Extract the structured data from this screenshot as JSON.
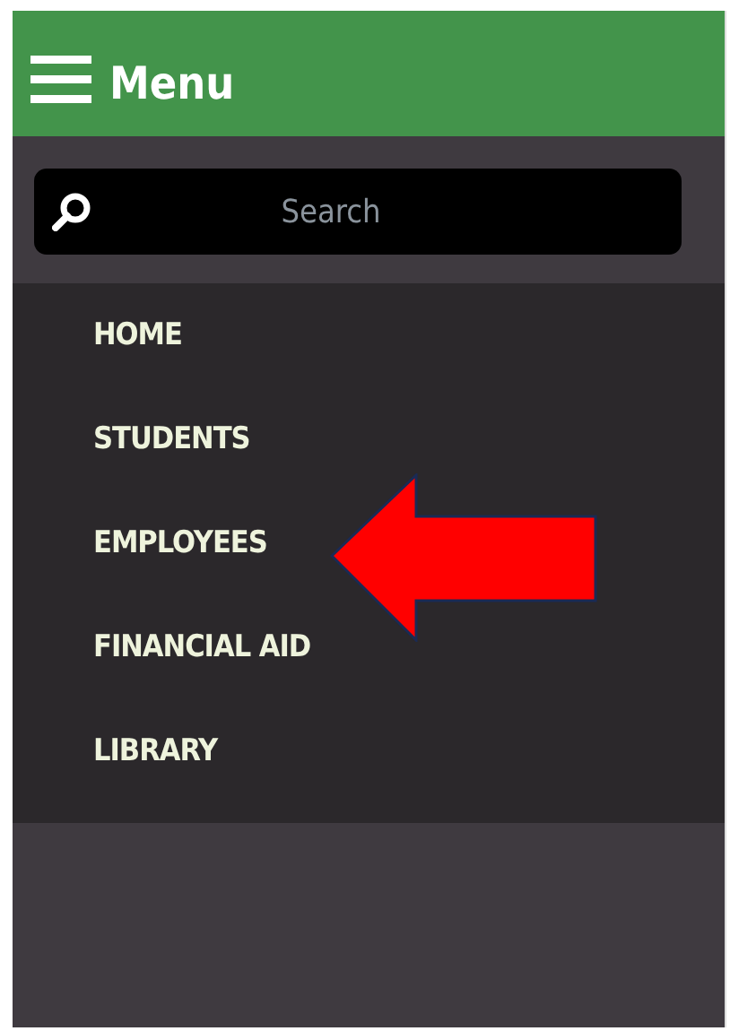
{
  "header": {
    "title": "Menu"
  },
  "search": {
    "placeholder": "Search"
  },
  "menu": [
    {
      "label": "HOME"
    },
    {
      "label": "STUDENTS"
    },
    {
      "label": "EMPLOYEES"
    },
    {
      "label": "FINANCIAL AID"
    },
    {
      "label": "LIBRARY"
    }
  ]
}
